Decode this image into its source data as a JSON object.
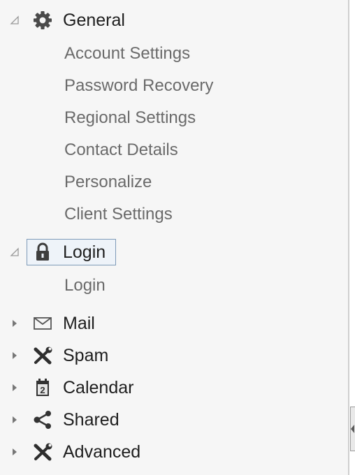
{
  "tree": {
    "general": {
      "label": "General",
      "icon": "gear-icon",
      "expanded": true,
      "children": [
        "Account Settings",
        "Password Recovery",
        "Regional Settings",
        "Contact Details",
        "Personalize",
        "Client Settings"
      ]
    },
    "login": {
      "label": "Login",
      "icon": "lock-icon",
      "expanded": true,
      "selected": true,
      "children": [
        "Login"
      ]
    },
    "mail": {
      "label": "Mail",
      "icon": "envelope-icon",
      "expanded": false
    },
    "spam": {
      "label": "Spam",
      "icon": "tools-icon",
      "expanded": false
    },
    "calendar": {
      "label": "Calendar",
      "icon": "calendar-icon",
      "expanded": false,
      "icon_text": "2"
    },
    "shared": {
      "label": "Shared",
      "icon": "share-icon",
      "expanded": false
    },
    "advanced": {
      "label": "Advanced",
      "icon": "tools-icon",
      "expanded": false
    }
  },
  "colors": {
    "background": "#f6f6f6",
    "label": "#1e1e1e",
    "child_label": "#6a6a6a",
    "selection_border": "#7e9ab8",
    "selection_fill": "#eef3f9"
  }
}
